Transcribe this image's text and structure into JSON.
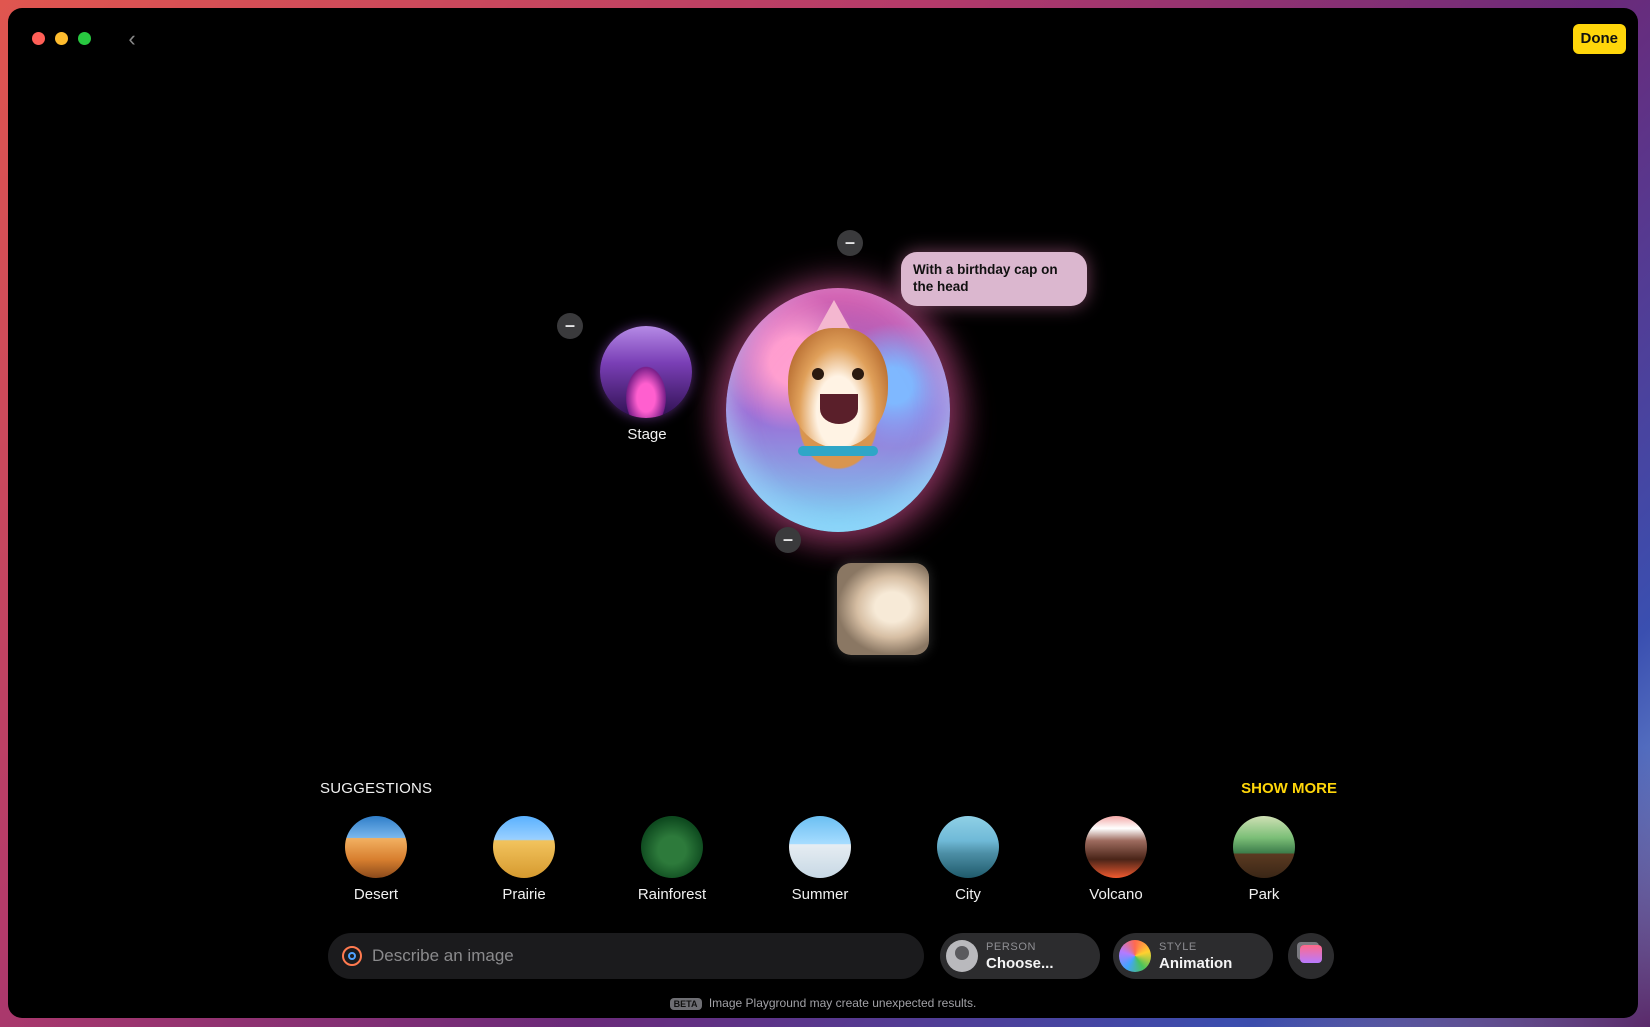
{
  "window": {
    "done_label": "Done"
  },
  "canvas": {
    "caption": "With a birthday cap on the head",
    "stage_label": "Stage",
    "remove_symbol": "–"
  },
  "suggestions": {
    "title": "SUGGESTIONS",
    "show_more": "SHOW MORE",
    "items": [
      {
        "label": "Desert",
        "icon": "desert-image"
      },
      {
        "label": "Prairie",
        "icon": "prairie-image"
      },
      {
        "label": "Rainforest",
        "icon": "rainforest-image"
      },
      {
        "label": "Summer",
        "icon": "summer-image"
      },
      {
        "label": "City",
        "icon": "city-image"
      },
      {
        "label": "Volcano",
        "icon": "volcano-image"
      },
      {
        "label": "Park",
        "icon": "park-image"
      }
    ]
  },
  "prompt": {
    "placeholder": "Describe an image"
  },
  "person": {
    "kicker": "PERSON",
    "value": "Choose..."
  },
  "style": {
    "kicker": "STYLE",
    "value": "Animation"
  },
  "footer": {
    "beta_tag": "BETA",
    "note": "Image Playground may create unexpected results."
  },
  "colors": {
    "accent": "#ffd60a",
    "background": "#000000"
  }
}
